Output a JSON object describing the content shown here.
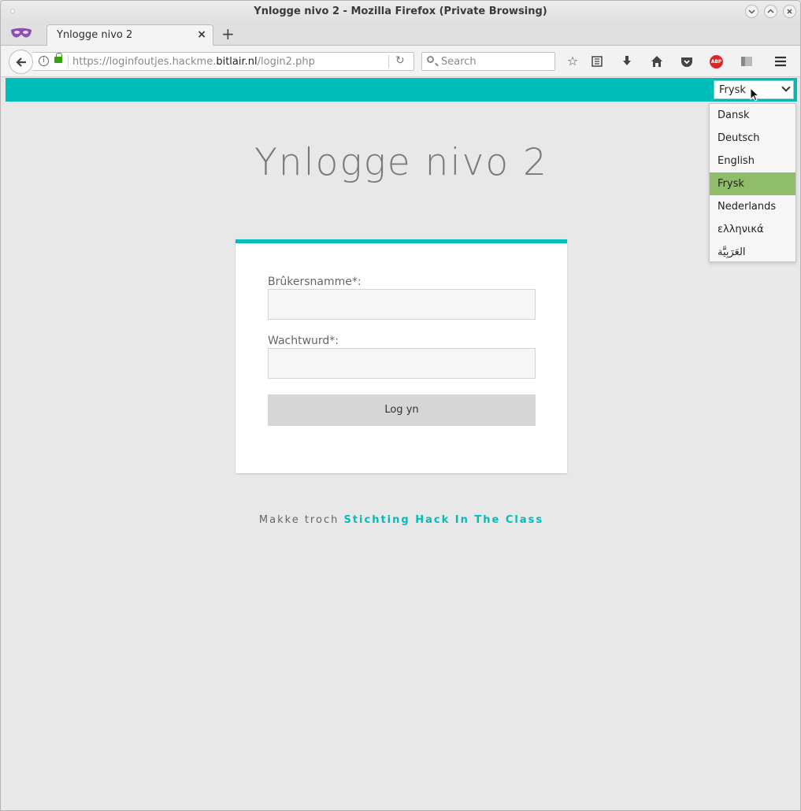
{
  "window": {
    "title": "Ynlogge nivo 2 - Mozilla Firefox (Private Browsing)"
  },
  "tab": {
    "label": "Ynlogge nivo 2",
    "close_glyph": "×",
    "newtab_glyph": "+"
  },
  "navbar": {
    "url_prefix": "https://loginfoutjes.hackme.",
    "url_domain": "bitlair.nl",
    "url_path": "/login2.php",
    "search_placeholder": "Search",
    "abp_label": "ABP"
  },
  "page": {
    "title": "Ynlogge nivo 2",
    "language_selected": "Frysk",
    "username_label": "Brûkersnamme*:",
    "username_value": "",
    "password_label": "Wachtwurd*:",
    "password_value": "",
    "login_button": "Log yn",
    "footer_prefix": "Makke troch",
    "footer_link": "Stichting Hack In The Class"
  },
  "language_options": [
    "Dansk",
    "Deutsch",
    "English",
    "Frysk",
    "Nederlands",
    "ελληνικά",
    "العَرَبِيَّة"
  ],
  "colors": {
    "accent": "#00bdb9",
    "selected_option": "#8fbd6a"
  },
  "icons": [
    "private-browsing-mask-icon",
    "back-arrow-icon",
    "info-icon",
    "lock-icon",
    "reload-icon",
    "search-icon",
    "star-icon",
    "reader-list-icon",
    "download-icon",
    "home-icon",
    "pocket-icon",
    "adblock-icon",
    "sidebar-icon",
    "hamburger-menu-icon",
    "chevron-down-icon",
    "mouse-cursor-icon"
  ]
}
